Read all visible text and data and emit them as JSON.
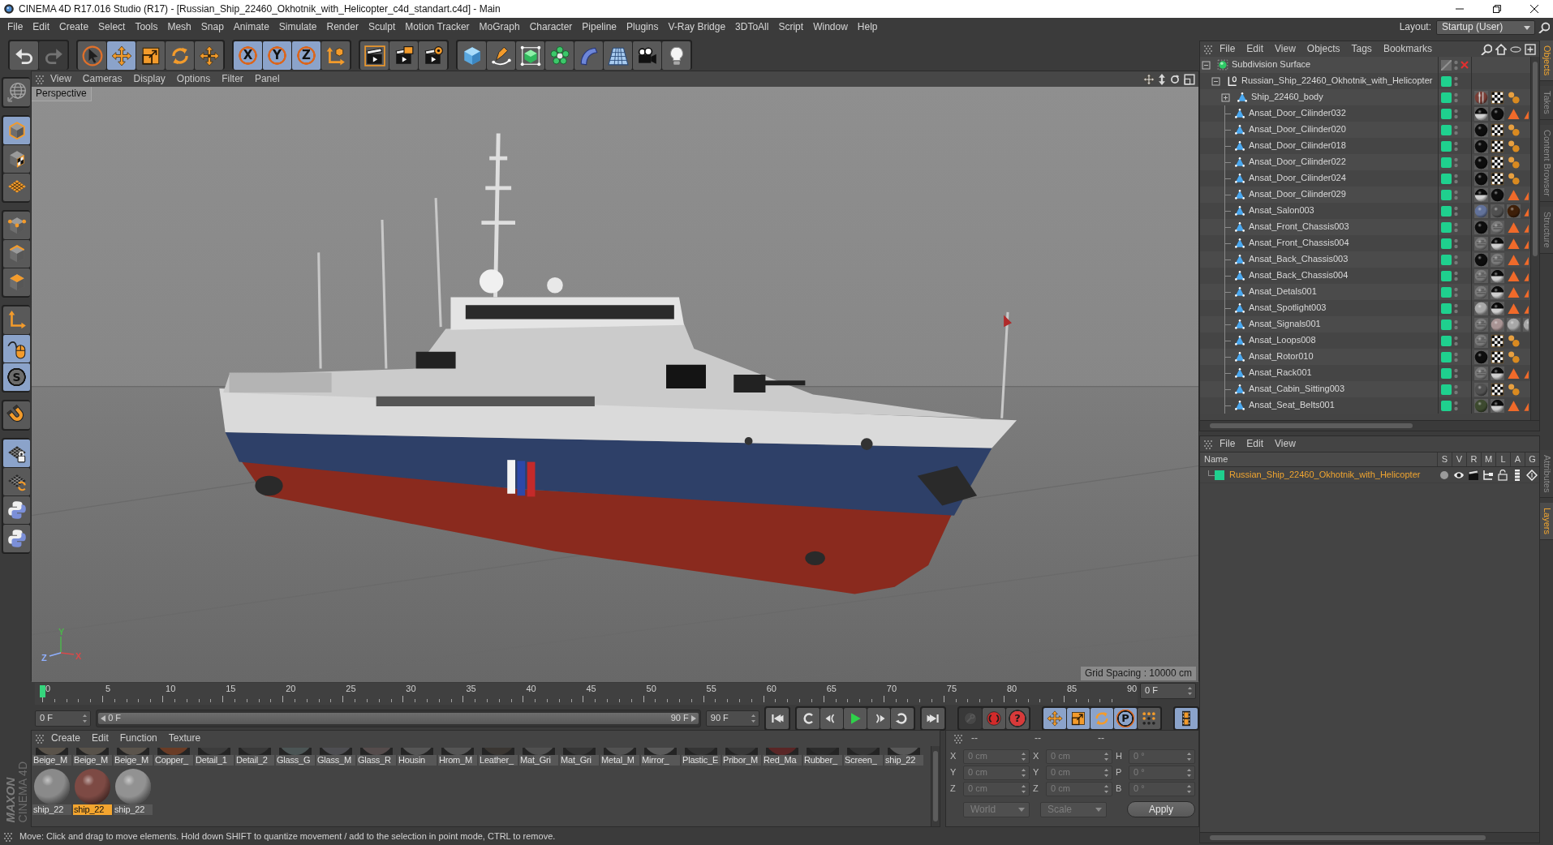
{
  "window": {
    "title": "CINEMA 4D R17.016 Studio (R17) - [Russian_Ship_22460_Okhotnik_with_Helicopter_c4d_standart.c4d] - Main"
  },
  "menu_bar": {
    "items": [
      "File",
      "Edit",
      "Create",
      "Select",
      "Tools",
      "Mesh",
      "Snap",
      "Animate",
      "Simulate",
      "Render",
      "Sculpt",
      "Motion Tracker",
      "MoGraph",
      "Character",
      "Pipeline",
      "Plugins",
      "V-Ray Bridge",
      "3DToAll",
      "Script",
      "Window",
      "Help"
    ],
    "layout_label": "Layout:",
    "layout_value": "Startup (User)"
  },
  "toolbar": {
    "groups": [
      [
        {
          "kind": "undo",
          "selected": false,
          "disabled": false
        },
        {
          "kind": "redo",
          "selected": false,
          "disabled": true
        }
      ],
      [
        {
          "kind": "select",
          "selected": false,
          "disabled": false
        },
        {
          "kind": "move",
          "selected": true,
          "disabled": false
        },
        {
          "kind": "scale",
          "selected": false,
          "disabled": false
        },
        {
          "kind": "rotate",
          "selected": false,
          "disabled": false
        },
        {
          "kind": "transform",
          "selected": false,
          "disabled": false
        }
      ],
      [
        {
          "kind": "axis",
          "label": "X",
          "selected": true,
          "disabled": false
        },
        {
          "kind": "axis",
          "label": "Y",
          "selected": true,
          "disabled": false
        },
        {
          "kind": "axis",
          "label": "Z",
          "selected": true,
          "disabled": false
        },
        {
          "kind": "coords",
          "selected": false,
          "disabled": false
        }
      ],
      [
        {
          "kind": "render-view",
          "selected": false,
          "disabled": false
        },
        {
          "kind": "render-picture",
          "selected": false,
          "disabled": false
        },
        {
          "kind": "render-settings",
          "selected": false,
          "disabled": false
        }
      ],
      [
        {
          "kind": "cube",
          "selected": false,
          "disabled": false
        },
        {
          "kind": "pen",
          "selected": false,
          "disabled": false
        },
        {
          "kind": "subdivision",
          "selected": false,
          "disabled": false
        },
        {
          "kind": "cloner",
          "selected": false,
          "disabled": false
        },
        {
          "kind": "bend",
          "selected": false,
          "disabled": false
        },
        {
          "kind": "floor",
          "selected": false,
          "disabled": false
        },
        {
          "kind": "camera",
          "selected": false,
          "disabled": false
        },
        {
          "kind": "light",
          "selected": false,
          "disabled": false
        }
      ]
    ]
  },
  "tool_palette": {
    "groups": [
      [
        {
          "kind": "make-editable",
          "selected": false
        }
      ],
      [
        {
          "kind": "model",
          "selected": true
        },
        {
          "kind": "texture",
          "selected": false
        },
        {
          "kind": "workplane",
          "selected": false
        }
      ],
      [
        {
          "kind": "points",
          "selected": false
        },
        {
          "kind": "edges",
          "selected": false
        },
        {
          "kind": "polygons",
          "selected": false
        }
      ],
      [
        {
          "kind": "axis-mode",
          "selected": false
        },
        {
          "kind": "tweak",
          "selected": true
        },
        {
          "kind": "snap",
          "label": "S",
          "selected": true
        }
      ],
      [
        {
          "kind": "magnet",
          "selected": false
        }
      ],
      [
        {
          "kind": "workplane-lock",
          "selected": true
        },
        {
          "kind": "workplane-align",
          "selected": false
        },
        {
          "kind": "python",
          "selected": false
        },
        {
          "kind": "python",
          "selected": false
        }
      ]
    ]
  },
  "branding": {
    "company": "MAXON",
    "product": "CINEMA 4D"
  },
  "viewport": {
    "menu": [
      "View",
      "Cameras",
      "Display",
      "Options",
      "Filter",
      "Panel"
    ],
    "camera": "Perspective",
    "grid_spacing": "Grid Spacing : 10000 cm",
    "axes": [
      {
        "label": "Y",
        "color": "#4cb44c"
      },
      {
        "label": "Z",
        "color": "#90b0ff"
      },
      {
        "label": "X",
        "color": "#d84a4a"
      }
    ]
  },
  "timeline": {
    "ticks": [
      "0",
      "5",
      "10",
      "15",
      "20",
      "25",
      "30",
      "35",
      "40",
      "45",
      "50",
      "55",
      "60",
      "65",
      "70",
      "75",
      "80",
      "85",
      "90"
    ],
    "level": 0,
    "frame_field": "0 F"
  },
  "playback": {
    "start_field": "0 F",
    "range": {
      "start": "0 F",
      "end": "90 F",
      "level": 1
    },
    "end_field": "90 F",
    "groups": [
      [
        {
          "kind": "first",
          "selected": false,
          "disabled": false
        }
      ],
      [
        {
          "kind": "prev-key",
          "selected": false,
          "disabled": false
        },
        {
          "kind": "prev-frame",
          "selected": false,
          "disabled": false
        },
        {
          "kind": "play",
          "selected": false,
          "disabled": false
        },
        {
          "kind": "next-frame",
          "selected": false,
          "disabled": false
        },
        {
          "kind": "next-key",
          "selected": false,
          "disabled": false
        }
      ],
      [
        {
          "kind": "last",
          "selected": false,
          "disabled": false
        }
      ],
      [
        {
          "kind": "key",
          "selected": false,
          "disabled": true
        },
        {
          "kind": "autokey",
          "selected": false,
          "disabled": false
        },
        {
          "kind": "help",
          "label": "?",
          "selected": false,
          "disabled": false
        }
      ],
      [
        {
          "kind": "move",
          "selected": true,
          "disabled": false
        },
        {
          "kind": "scale",
          "selected": true,
          "disabled": false
        },
        {
          "kind": "rotate",
          "selected": true,
          "disabled": false
        },
        {
          "kind": "param",
          "label": "P",
          "selected": true,
          "disabled": false
        },
        {
          "kind": "points-anim",
          "selected": false,
          "disabled": false
        }
      ],
      [
        {
          "kind": "timeline",
          "selected": true,
          "disabled": false
        }
      ]
    ]
  },
  "material_manager": {
    "menu": [
      "Create",
      "Edit",
      "Function",
      "Texture"
    ],
    "rows": [
      [
        {
          "name": "Beige_M",
          "color": "#5a534a",
          "selected": false
        },
        {
          "name": "Beige_M",
          "color": "#58524a",
          "selected": false
        },
        {
          "name": "Beige_M",
          "color": "#5b544c",
          "selected": false
        },
        {
          "name": "Copper_",
          "color": "#6a3c26",
          "selected": false
        },
        {
          "name": "Detail_1",
          "color": "#3c3c3c",
          "selected": false
        },
        {
          "name": "Detail_2",
          "color": "#393939",
          "selected": false
        },
        {
          "name": "Glass_G",
          "color": "#4c5555",
          "selected": false
        },
        {
          "name": "Glass_M",
          "color": "#4e4e52",
          "selected": false
        },
        {
          "name": "Glass_R",
          "color": "#554c4c",
          "selected": false
        },
        {
          "name": "Housin",
          "color": "#565656",
          "selected": false
        },
        {
          "name": "Hrom_M",
          "color": "#555555",
          "selected": false
        },
        {
          "name": "Leather_",
          "color": "#3a3632",
          "selected": false
        },
        {
          "name": "Mat_Gri",
          "color": "#505050",
          "selected": false
        },
        {
          "name": "Mat_Gri",
          "color": "#373737",
          "selected": false
        },
        {
          "name": "Metal_M",
          "color": "#525252",
          "selected": false
        },
        {
          "name": "Mirror_",
          "color": "#5a5a5a",
          "selected": false
        },
        {
          "name": "Plastic_E",
          "color": "#353535",
          "selected": false
        },
        {
          "name": "Pribor_M",
          "color": "#383838",
          "selected": false
        },
        {
          "name": "Red_Ma",
          "color": "#5a2626",
          "selected": false
        },
        {
          "name": "Rubber_",
          "color": "#2c2c2c",
          "selected": false
        },
        {
          "name": "Screen_",
          "color": "#363636",
          "selected": false
        },
        {
          "name": "ship_22",
          "color": "#585858",
          "selected": false
        }
      ],
      [
        {
          "name": "ship_22",
          "color": "#8a8a8a",
          "selected": false
        },
        {
          "name": "ship_22",
          "color": "#7d4a44",
          "selected": true
        },
        {
          "name": "ship_22",
          "color": "#929292",
          "selected": false
        }
      ]
    ]
  },
  "coordinates": {
    "headers": [
      "--",
      "--",
      "--"
    ],
    "disabled": true,
    "rows": [
      {
        "position_axis": "X",
        "position": "0 cm",
        "size_axis": "X",
        "size": "0 cm",
        "rotation_axis": "H",
        "rotation": "0 °"
      },
      {
        "position_axis": "Y",
        "position": "0 cm",
        "size_axis": "Y",
        "size": "0 cm",
        "rotation_axis": "P",
        "rotation": "0 °"
      },
      {
        "position_axis": "Z",
        "position": "0 cm",
        "size_axis": "Z",
        "size": "0 cm",
        "rotation_axis": "B",
        "rotation": "0 °"
      }
    ],
    "space": "World",
    "mode": "Scale",
    "apply": "Apply"
  },
  "status_bar": {
    "text": "Move: Click and drag to move elements. Hold down SHIFT to quantize movement / add to the selection in point mode, CTRL to remove."
  },
  "objects": {
    "menu": [
      "File",
      "Edit",
      "View",
      "Objects",
      "Tags",
      "Bookmarks"
    ],
    "tree": [
      {
        "name": "Subdivision Surface",
        "kind": "subdivision",
        "expanded": true,
        "selected": false,
        "disabled": true,
        "on_layer": false,
        "children": [
          {
            "name": "Russian_Ship_22460_Okhotnik_with_Helicopter",
            "kind": "null",
            "expanded": true,
            "selected": false,
            "disabled": false,
            "on_layer": true,
            "children": [
              {
                "name": "Ship_22460_body",
                "kind": "polygon",
                "expanded": false,
                "selected": false,
                "disabled": false,
                "on_layer": true,
                "tags": [
                  {
                    "kind": "texture"
                  },
                  {
                    "kind": "checker"
                  },
                  {
                    "kind": "phong"
                  }
                ]
              },
              {
                "name": "Ansat_Door_Cilinder032",
                "kind": "polygon",
                "selected": false,
                "disabled": false,
                "on_layer": true,
                "tags": [
                  {
                    "kind": "chrome"
                  },
                  {
                    "kind": "black"
                  },
                  {
                    "kind": "triangle"
                  },
                  {
                    "kind": "triangle"
                  }
                ]
              },
              {
                "name": "Ansat_Door_Cilinder020",
                "kind": "polygon",
                "selected": false,
                "disabled": false,
                "on_layer": true,
                "tags": [
                  {
                    "kind": "black"
                  },
                  {
                    "kind": "checker"
                  },
                  {
                    "kind": "phong"
                  }
                ]
              },
              {
                "name": "Ansat_Door_Cilinder018",
                "kind": "polygon",
                "selected": false,
                "disabled": false,
                "on_layer": true,
                "tags": [
                  {
                    "kind": "black"
                  },
                  {
                    "kind": "checker"
                  },
                  {
                    "kind": "phong"
                  }
                ]
              },
              {
                "name": "Ansat_Door_Cilinder022",
                "kind": "polygon",
                "selected": false,
                "disabled": false,
                "on_layer": true,
                "tags": [
                  {
                    "kind": "black"
                  },
                  {
                    "kind": "checker"
                  },
                  {
                    "kind": "phong"
                  }
                ]
              },
              {
                "name": "Ansat_Door_Cilinder024",
                "kind": "polygon",
                "selected": false,
                "disabled": false,
                "on_layer": true,
                "tags": [
                  {
                    "kind": "black"
                  },
                  {
                    "kind": "checker"
                  },
                  {
                    "kind": "phong"
                  }
                ]
              },
              {
                "name": "Ansat_Door_Cilinder029",
                "kind": "polygon",
                "selected": false,
                "disabled": false,
                "on_layer": true,
                "tags": [
                  {
                    "kind": "chrome"
                  },
                  {
                    "kind": "black"
                  },
                  {
                    "kind": "triangle"
                  },
                  {
                    "kind": "triangle"
                  }
                ]
              },
              {
                "name": "Ansat_Salon003",
                "kind": "polygon",
                "selected": false,
                "disabled": false,
                "on_layer": true,
                "tags": [
                  {
                    "kind": "blue"
                  },
                  {
                    "kind": "grey"
                  },
                  {
                    "kind": "brown"
                  },
                  {
                    "kind": "triangle"
                  }
                ]
              },
              {
                "name": "Ansat_Front_Chassis003",
                "kind": "polygon",
                "selected": false,
                "disabled": false,
                "on_layer": true,
                "tags": [
                  {
                    "kind": "black"
                  },
                  {
                    "kind": "metal"
                  },
                  {
                    "kind": "triangle"
                  },
                  {
                    "kind": "triangle"
                  }
                ]
              },
              {
                "name": "Ansat_Front_Chassis004",
                "kind": "polygon",
                "selected": false,
                "disabled": false,
                "on_layer": true,
                "tags": [
                  {
                    "kind": "metal"
                  },
                  {
                    "kind": "chrome"
                  },
                  {
                    "kind": "triangle"
                  },
                  {
                    "kind": "triangle"
                  }
                ]
              },
              {
                "name": "Ansat_Back_Chassis003",
                "kind": "polygon",
                "selected": false,
                "disabled": false,
                "on_layer": true,
                "tags": [
                  {
                    "kind": "black"
                  },
                  {
                    "kind": "metal"
                  },
                  {
                    "kind": "triangle"
                  },
                  {
                    "kind": "triangle"
                  }
                ]
              },
              {
                "name": "Ansat_Back_Chassis004",
                "kind": "polygon",
                "selected": false,
                "disabled": false,
                "on_layer": true,
                "tags": [
                  {
                    "kind": "metal"
                  },
                  {
                    "kind": "chrome"
                  },
                  {
                    "kind": "triangle"
                  },
                  {
                    "kind": "triangle"
                  }
                ]
              },
              {
                "name": "Ansat_Detals001",
                "kind": "polygon",
                "selected": false,
                "disabled": false,
                "on_layer": true,
                "tags": [
                  {
                    "kind": "metal"
                  },
                  {
                    "kind": "chrome"
                  },
                  {
                    "kind": "triangle"
                  },
                  {
                    "kind": "triangle"
                  }
                ]
              },
              {
                "name": "Ansat_Spotlight003",
                "kind": "polygon",
                "selected": false,
                "disabled": false,
                "on_layer": true,
                "tags": [
                  {
                    "kind": "silver"
                  },
                  {
                    "kind": "chrome"
                  },
                  {
                    "kind": "triangle"
                  },
                  {
                    "kind": "triangle"
                  }
                ]
              },
              {
                "name": "Ansat_Signals001",
                "kind": "polygon",
                "selected": false,
                "disabled": false,
                "on_layer": true,
                "tags": [
                  {
                    "kind": "metal"
                  },
                  {
                    "kind": "pink"
                  },
                  {
                    "kind": "silver"
                  },
                  {
                    "kind": "silver"
                  }
                ]
              },
              {
                "name": "Ansat_Loops008",
                "kind": "polygon",
                "selected": false,
                "disabled": false,
                "on_layer": true,
                "tags": [
                  {
                    "kind": "metal"
                  },
                  {
                    "kind": "checker"
                  },
                  {
                    "kind": "phong"
                  }
                ]
              },
              {
                "name": "Ansat_Rotor010",
                "kind": "polygon",
                "selected": false,
                "disabled": false,
                "on_layer": true,
                "tags": [
                  {
                    "kind": "black"
                  },
                  {
                    "kind": "checker"
                  },
                  {
                    "kind": "phong"
                  }
                ]
              },
              {
                "name": "Ansat_Rack001",
                "kind": "polygon",
                "selected": false,
                "disabled": false,
                "on_layer": true,
                "tags": [
                  {
                    "kind": "metal"
                  },
                  {
                    "kind": "chrome"
                  },
                  {
                    "kind": "triangle"
                  },
                  {
                    "kind": "triangle"
                  }
                ]
              },
              {
                "name": "Ansat_Cabin_Sitting003",
                "kind": "polygon",
                "selected": false,
                "disabled": false,
                "on_layer": true,
                "tags": [
                  {
                    "kind": "grey"
                  },
                  {
                    "kind": "checker"
                  },
                  {
                    "kind": "phong"
                  }
                ]
              },
              {
                "name": "Ansat_Seat_Belts001",
                "kind": "polygon",
                "selected": false,
                "disabled": false,
                "on_layer": true,
                "tags": [
                  {
                    "kind": "green"
                  },
                  {
                    "kind": "chrome"
                  },
                  {
                    "kind": "triangle"
                  },
                  {
                    "kind": "triangle"
                  }
                ]
              }
            ]
          }
        ]
      }
    ]
  },
  "layers": {
    "menu": [
      "File",
      "Edit",
      "View"
    ],
    "columns": [
      "Name",
      "S",
      "V",
      "R",
      "M",
      "L",
      "A",
      "G"
    ],
    "rows": [
      {
        "name": "Russian_Ship_22460_Okhotnik_with_Helicopter",
        "color": "#1fd08e"
      }
    ]
  },
  "side_tabs": {
    "top": [
      {
        "label": "Objects",
        "selected": true
      },
      {
        "label": "Takes",
        "selected": false
      },
      {
        "label": "Content Browser",
        "selected": false
      },
      {
        "label": "Structure",
        "selected": false
      }
    ],
    "bottom": [
      {
        "label": "Attributes",
        "selected": false
      },
      {
        "label": "Layers",
        "selected": true
      }
    ]
  }
}
